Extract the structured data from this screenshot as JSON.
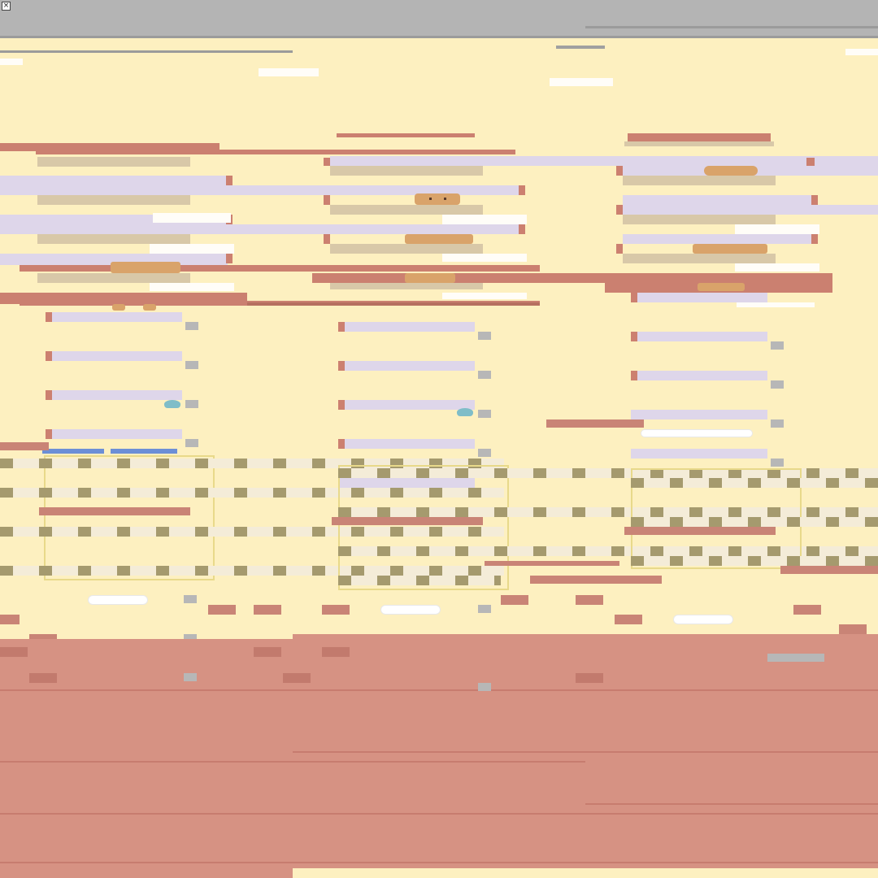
{
  "window": {
    "close_glyph": "×"
  },
  "scene": {
    "palette": {
      "wall": "#fdf0c0",
      "shelf": "#cb8070",
      "plank": "#d8c8a8",
      "lavender": "#ded6ea",
      "floor": "#d69283",
      "checker_dark": "#a59a6e",
      "checker_light": "#f4ecd8",
      "teddy": "#d9a36a",
      "toolbar_grey": "#b4b4b4"
    },
    "icons": [
      "close-icon",
      "teddy-bear-icon",
      "flower-pot-icon",
      "water-drop-icon"
    ]
  }
}
